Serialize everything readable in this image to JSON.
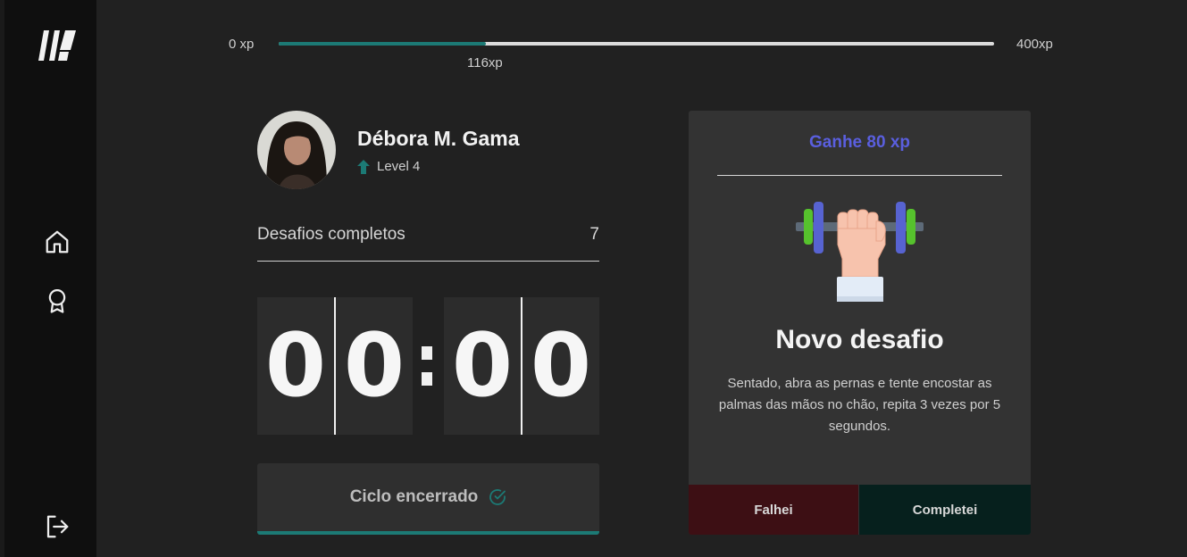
{
  "sidebar": {
    "logo_icon": "brand-logo",
    "nav": [
      {
        "icon": "home-icon"
      },
      {
        "icon": "award-icon"
      }
    ],
    "logout_icon": "logout-icon"
  },
  "xp_bar": {
    "min_label": "0 xp",
    "max_label": "400xp",
    "current_label": "116xp",
    "progress": 0.29,
    "fill_color": "#1c7a75"
  },
  "profile": {
    "name": "Débora M. Gama",
    "level_label": "Level 4",
    "level_icon": "arrow-up-icon"
  },
  "stats": {
    "challenges_label": "Desafios completos",
    "challenges_value": "7"
  },
  "countdown": {
    "minutes": [
      "0",
      "0"
    ],
    "seconds": [
      "0",
      "0"
    ]
  },
  "cycle_button": {
    "label": "Ciclo encerrado",
    "icon": "check-circle-icon"
  },
  "challenge_card": {
    "reward": "Ganhe 80 xp",
    "illustration": "dumbbell-icon",
    "title": "Novo desafio",
    "description": "Sentado, abra as pernas e tente encostar as palmas das mãos no chão, repita 3 vezes por 5 segundos.",
    "fail_label": "Falhei",
    "complete_label": "Completei",
    "accent_color": "#5a5fdf"
  }
}
